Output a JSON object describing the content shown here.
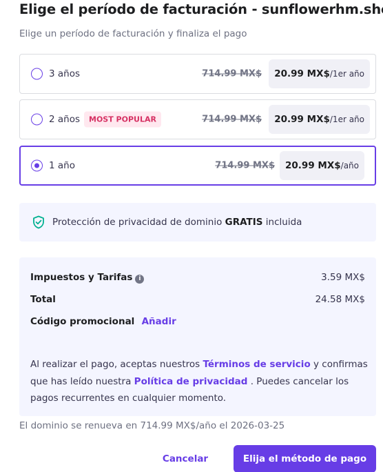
{
  "header": {
    "title": "Elige el período de facturación - sunflowerhm.shop",
    "subtitle": "Elige un período de facturación y finaliza el pago"
  },
  "plans": [
    {
      "label": "3 años",
      "old_price": "714.99 MX$",
      "price": "20.99 MX$",
      "per": "/1er año",
      "selected": false
    },
    {
      "label": "2 años",
      "badge": "MOST POPULAR",
      "old_price": "714.99 MX$",
      "price": "20.99 MX$",
      "per": "/1er año",
      "selected": false
    },
    {
      "label": "1 año",
      "old_price": "714.99 MX$",
      "price": "20.99 MX$",
      "per": "/año",
      "selected": true
    }
  ],
  "privacy": {
    "icon": "shield-check-icon",
    "text_before": "Protección de privacidad de dominio ",
    "text_bold": "GRATIS",
    "text_after": " incluida"
  },
  "summary": {
    "taxes_label": "Impuestos y Tarifas",
    "taxes_value": "3.59 MX$",
    "total_label": "Total",
    "total_value": "24.58 MX$",
    "promo_label": "Código promocional",
    "promo_link": "Añadir",
    "terms_1": "Al realizar el pago, aceptas nuestros ",
    "terms_link": "Términos de servicio",
    "terms_2": " y confirmas que has leído nuestra ",
    "privacy_link": "Política de privacidad",
    "terms_3": " . Puedes cancelar los pagos recurrentes en cualquier momento."
  },
  "renewal_note": "El dominio se renueva en 714.99 MX$/año el 2026-03-25",
  "actions": {
    "cancel_label": "Cancelar",
    "pay_label": "Elija el método de pago"
  },
  "colors": {
    "accent": "#673de6",
    "badge_bg": "#ffe8ef",
    "badge_text": "#d63163",
    "shield": "#00b090"
  }
}
